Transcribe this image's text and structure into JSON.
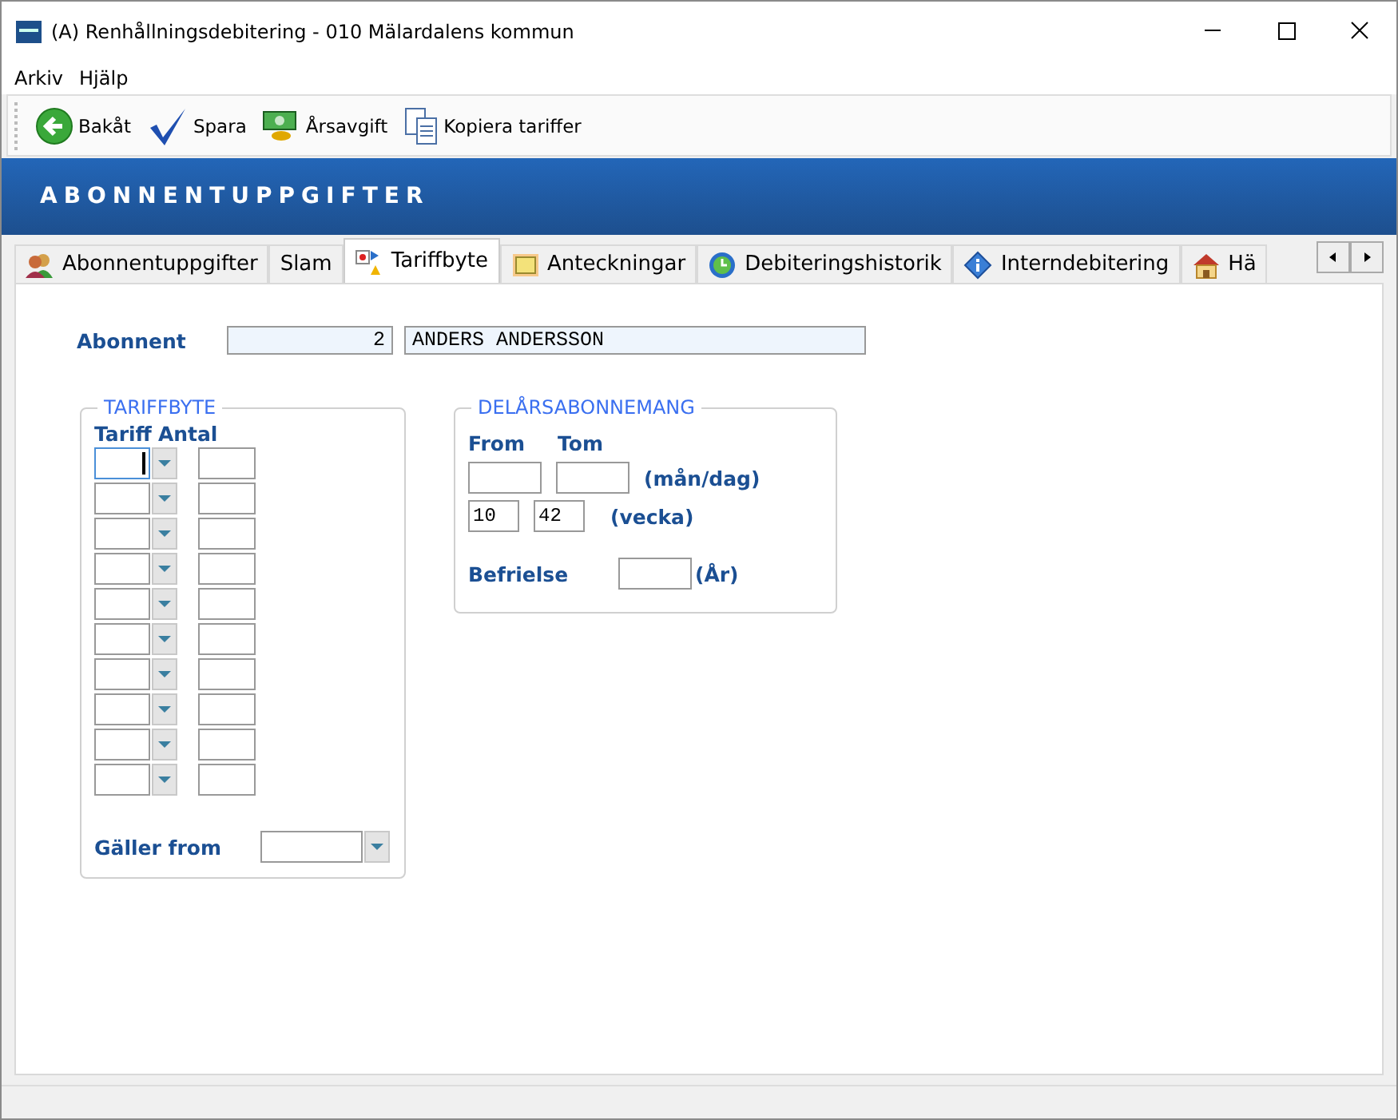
{
  "window": {
    "title": "(A)  Renhållningsdebitering  -  010 Mälardalens kommun"
  },
  "menu": [
    "Arkiv",
    "Hjälp"
  ],
  "toolbar": [
    {
      "kind": "back",
      "label": "Bakåt"
    },
    {
      "kind": "save",
      "label": "Spara"
    },
    {
      "kind": "fee",
      "label": "Årsavgift"
    },
    {
      "kind": "copy",
      "label": "Kopiera tariffer"
    }
  ],
  "header": "ABONNENTUPPGIFTER",
  "tabs": [
    {
      "label": "Abonnentuppgifter",
      "selected": false
    },
    {
      "label": "Slam",
      "selected": false
    },
    {
      "label": "Tariffbyte",
      "selected": true
    },
    {
      "label": "Anteckningar",
      "selected": false
    },
    {
      "label": "Debiteringshistorik",
      "selected": false
    },
    {
      "label": "Interndebitering",
      "selected": false
    },
    {
      "label": "Hä",
      "selected": false
    }
  ],
  "subscriber": {
    "label": "Abonnent",
    "number": "2",
    "name": "ANDERS ANDERSSON"
  },
  "tariff_group": {
    "title": "TARIFFBYTE",
    "column_1": "Tariff",
    "column_2": "Antal",
    "valid_from_label": "Gäller from"
  },
  "partial_group": {
    "title": "DELÅRSABONNEMANG",
    "from_label": "From",
    "to_label": "Tom",
    "unit_1": "(mån/dag)",
    "week_from": "10",
    "week_to": "42",
    "unit_2": "(vecka)",
    "exemption_label": "Befrielse",
    "exemption_unit": "(År)"
  }
}
